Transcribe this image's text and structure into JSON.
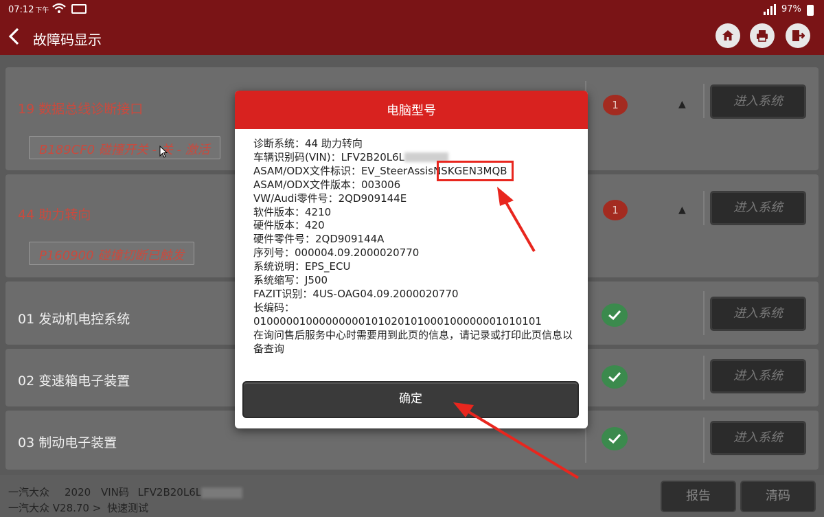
{
  "status_bar": {
    "time": "07:12",
    "ampm": "下午",
    "battery": "97%"
  },
  "header": {
    "title": "故障码显示",
    "icons": [
      "back-icon",
      "home-icon",
      "print-icon",
      "exit-icon"
    ]
  },
  "systems": [
    {
      "name": "19 数据总线诊断接口",
      "status": "fault",
      "fault_count": "1",
      "fault_code": "B189CF0 碰撞开关 - 关 - 激活",
      "enter_label": "进入系统"
    },
    {
      "name": "44 助力转向",
      "status": "fault",
      "fault_count": "1",
      "fault_code": "P160900 碰撞切断已触发",
      "enter_label": "进入系统"
    },
    {
      "name": "01 发动机电控系统",
      "status": "ok",
      "enter_label": "进入系统"
    },
    {
      "name": "02 变速箱电子装置",
      "status": "ok",
      "enter_label": "进入系统"
    },
    {
      "name": "03 制动电子装置",
      "status": "ok",
      "enter_label": "进入系统"
    }
  ],
  "bottom": {
    "make": "一汽大众",
    "year": "2020",
    "vin_label": "VIN码",
    "vin_partial": "LFV2B20L6L",
    "path": "一汽大众 V28.70 >",
    "mode": "快速测试",
    "report_label": "报告",
    "clear_label": "清码"
  },
  "dialog": {
    "title": "电脑型号",
    "lines": [
      "诊断系统：44 助力转向",
      "ASAM/ODX文件标识：EV_SteerAssisNSKGEN3MQB",
      "ASAM/ODX文件版本：003006",
      "VW/Audi零件号：2QD909144E",
      "软件版本：4210",
      "硬件版本：420",
      "硬件零件号：2QD909144A",
      "序列号：000004.09.2000020770",
      "系统说明：EPS_ECU",
      "系统缩写：J500",
      "FAZIT识别：4US-OAG04.09.2000020770",
      "长编码：",
      "01000001000000000101020101000100000001010101",
      "在询问售后服务中心时需要用到此页的信息，请记录或打印此页信息以备查询"
    ],
    "vin_line": "车辆识别码(VIN)：LFV2B20L6L",
    "confirm_label": "确定"
  },
  "colors": {
    "header_bg": "#7a1416",
    "dialog_header": "#d8221f",
    "fault_text": "#c94a3e",
    "ok_badge": "#3b8a4d",
    "fault_badge": "#a32b20",
    "highlight": "#e8261e"
  }
}
